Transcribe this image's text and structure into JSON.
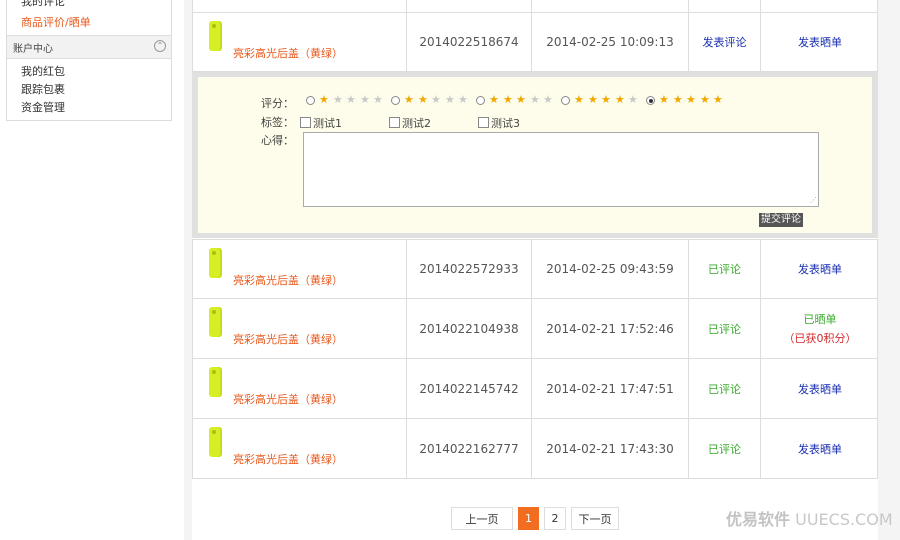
{
  "sidebar": {
    "items_top": [
      "我的评论",
      "商品评价/晒单"
    ],
    "section_title": "账户中心",
    "section_items": [
      "我的红包",
      "跟踪包裹",
      "资金管理"
    ]
  },
  "rows": [
    {
      "product": "亮彩高光后盖（黄绿）",
      "order_no": "2014022518674",
      "date": "2014-02-25 10:09:13",
      "status": "发表评论",
      "action": "发表晒单"
    },
    {
      "product": "亮彩高光后盖（黄绿）",
      "order_no": "2014022572933",
      "date": "2014-02-25 09:43:59",
      "status": "已评论",
      "action": "发表晒单"
    },
    {
      "product": "亮彩高光后盖（黄绿）",
      "order_no": "2014022104938",
      "date": "2014-02-21 17:52:46",
      "status": "已评论",
      "action": "已晒单",
      "action_note": "（已获0积分）"
    },
    {
      "product": "亮彩高光后盖（黄绿）",
      "order_no": "2014022145742",
      "date": "2014-02-21 17:47:51",
      "status": "已评论",
      "action": "发表晒单"
    },
    {
      "product": "亮彩高光后盖（黄绿）",
      "order_no": "2014022162777",
      "date": "2014-02-21 17:43:30",
      "status": "已评论",
      "action": "发表晒单"
    }
  ],
  "review_form": {
    "rating_label": "评分：",
    "tags_label": "标签：",
    "notes_label": "心得：",
    "rating_options": [
      1,
      2,
      3,
      4,
      5
    ],
    "selected_rating": 5,
    "tags": [
      "测试1",
      "测试2",
      "测试3"
    ],
    "textarea_value": "",
    "submit_label": "提交评论"
  },
  "pagination": {
    "prev": "上一页",
    "pages": [
      "1",
      "2"
    ],
    "current": "1",
    "next": "下一页"
  },
  "watermark": {
    "brand": "优易软件",
    "domain": "UUECS.COM"
  },
  "colors": {
    "accent": "#f26d1f",
    "link": "#1a2fb0",
    "done": "#3aaa2c",
    "product": "#e8591c",
    "star": "#f0a800"
  }
}
